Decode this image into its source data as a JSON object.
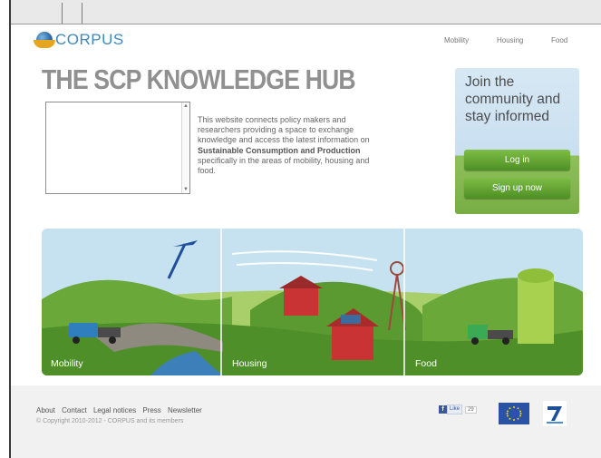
{
  "header": {
    "logo_text": "CORPUS",
    "nav": [
      "Mobility",
      "Housing",
      "Food"
    ]
  },
  "hero": {
    "title": "THE SCP KNOWLEDGE HUB",
    "intro_line1": "This website connects policy makers and",
    "intro_line2": "researchers providing a space to exchange",
    "intro_line3": "knowledge and access the latest information on",
    "intro_bold": "Sustainable Consumption and Production",
    "intro_line5": "specifically in the areas of mobility, housing and",
    "intro_line6": "food."
  },
  "join": {
    "line1": "Join the",
    "line2": "community and",
    "line3": "stay informed",
    "login_label": "Log in",
    "signup_label": "Sign up now"
  },
  "banner": {
    "labels": [
      "Mobility",
      "Housing",
      "Food"
    ]
  },
  "footer": {
    "links": [
      "About",
      "Contact",
      "Legal notices",
      "Press",
      "Newsletter"
    ],
    "copyright": "© Copyright 2010-2012 - CORPUS and its members",
    "like_label": "Like",
    "like_count": "29"
  },
  "colors": {
    "brand_blue": "#3f88bd",
    "green_button": "#5ea333",
    "sky": "#c6e2f1"
  }
}
